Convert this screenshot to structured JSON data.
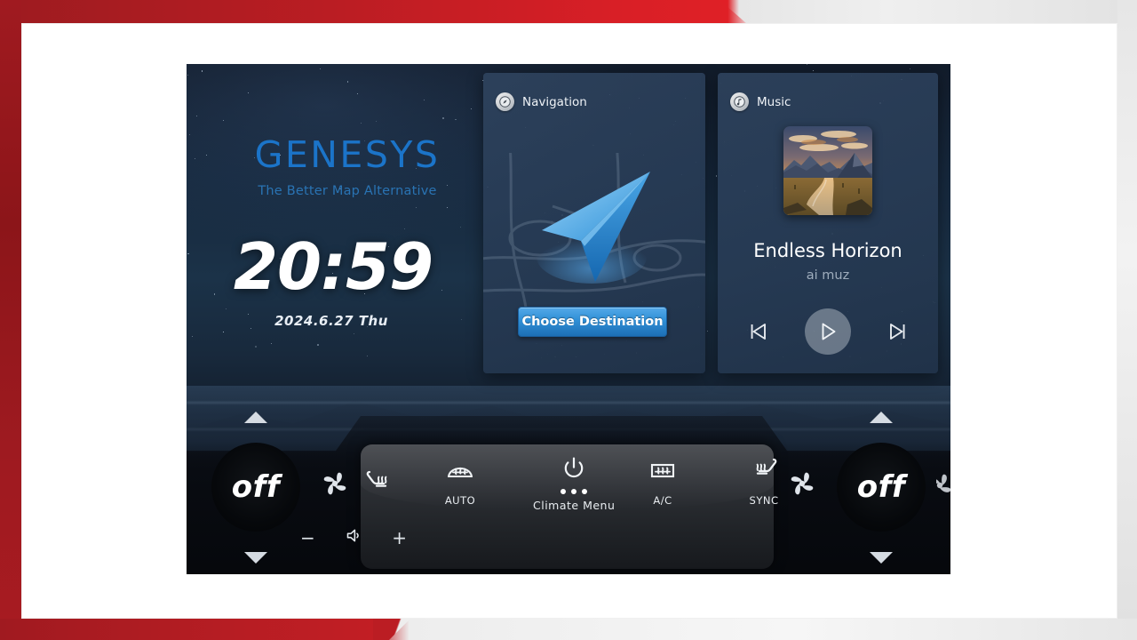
{
  "frame": {
    "accent_color": "#c21e24",
    "panel_color": "#eeeeee"
  },
  "screen": {
    "brand": {
      "logo_text": "GENESYS",
      "tagline": "The Better Map Alternative",
      "logo_color": "#1b74c9"
    },
    "clock": {
      "time": "20:59",
      "date": "2024.6.27  Thu"
    },
    "navigation": {
      "icon": "compass-icon",
      "title": "Navigation",
      "button_label": "Choose Destination",
      "button_color": "#2f8fd6"
    },
    "music": {
      "icon": "music-note-icon",
      "title": "Music",
      "track_title": "Endless Horizon",
      "artist": "ai muz",
      "album_art": "mountain-sunset-river-landscape",
      "controls": {
        "previous": "previous-track-icon",
        "play": "play-icon",
        "next": "next-track-icon"
      }
    },
    "climate": {
      "left_dial": {
        "value": "off",
        "up": "temp-up",
        "down": "temp-down"
      },
      "right_dial": {
        "value": "off",
        "up": "temp-up",
        "down": "temp-down"
      },
      "volume": {
        "minus": "−",
        "plus": "+",
        "icon": "speaker-icon"
      },
      "buttons": [
        {
          "name": "driver-seat-heater",
          "icon": "seat-heater-icon",
          "label": ""
        },
        {
          "name": "auto-climate",
          "icon": "rear-defrost-icon",
          "label": "AUTO"
        },
        {
          "name": "climate-menu",
          "icon": "power-icon",
          "label": "Climate Menu",
          "dots": 3
        },
        {
          "name": "ac-toggle",
          "icon": "front-defrost-icon",
          "label": "A/C"
        },
        {
          "name": "sync-toggle",
          "icon": "seat-heater-icon",
          "label": "SYNC"
        }
      ],
      "fan_left": "fan-icon",
      "fan_right": "fan-icon"
    }
  }
}
